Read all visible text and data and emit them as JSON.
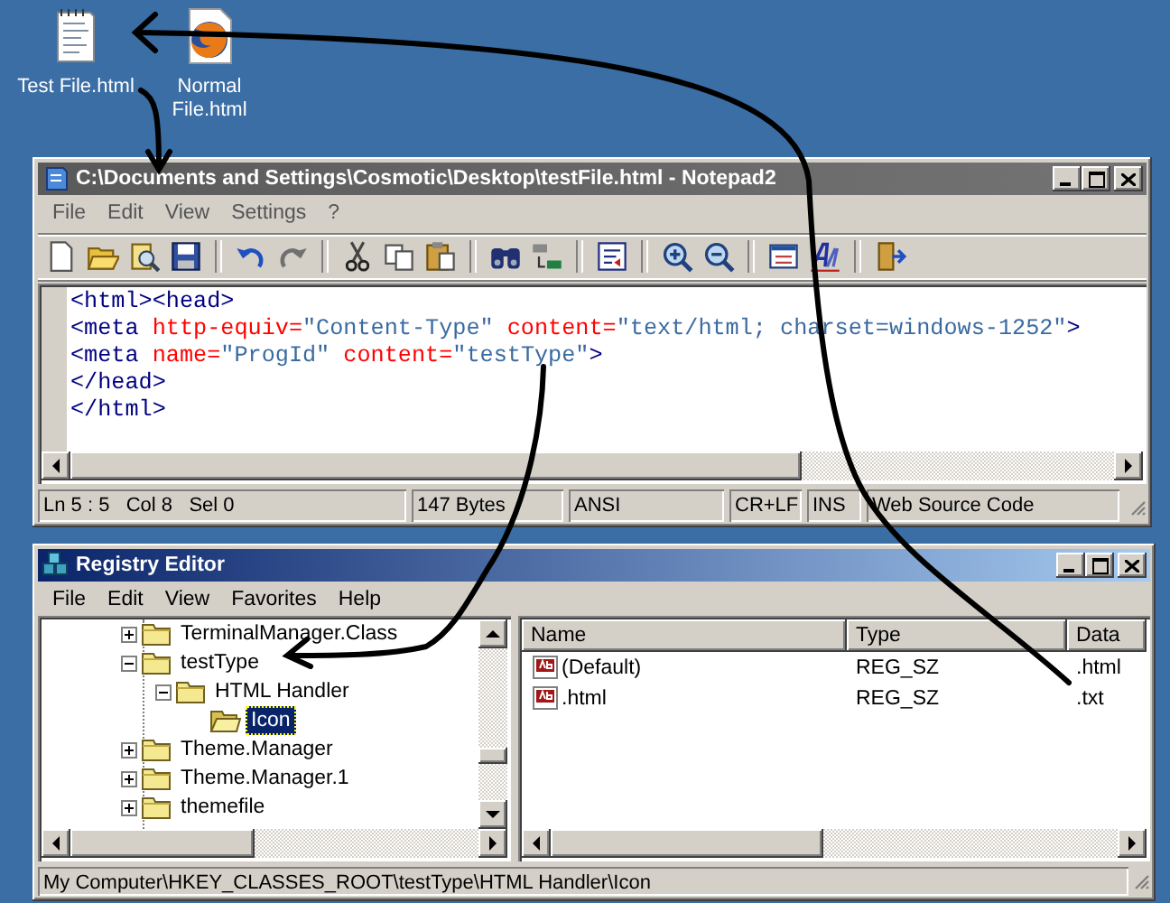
{
  "desktop_icons": [
    {
      "label": "Test File.html",
      "kind": "notepad"
    },
    {
      "label": "Normal File.html",
      "kind": "browser"
    }
  ],
  "notepad": {
    "title": "C:\\Documents and Settings\\Cosmotic\\Desktop\\testFile.html - Notepad2",
    "active": false,
    "menu": [
      "File",
      "Edit",
      "View",
      "Settings",
      "?"
    ],
    "code_lines": [
      [
        {
          "kind": "tag",
          "text": "<html><head>"
        }
      ],
      [
        {
          "kind": "tag",
          "text": "<meta"
        },
        {
          "kind": "attr",
          "text": " http-equiv"
        },
        {
          "kind": "op",
          "text": "="
        },
        {
          "kind": "value",
          "text": "\"Content-Type\""
        },
        {
          "kind": "attr",
          "text": " content"
        },
        {
          "kind": "op",
          "text": "="
        },
        {
          "kind": "value",
          "text": "\"text/html; charset=windows-1252\""
        },
        {
          "kind": "tag",
          "text": ">"
        }
      ],
      [
        {
          "kind": "tag",
          "text": "<meta"
        },
        {
          "kind": "attr",
          "text": " name"
        },
        {
          "kind": "op",
          "text": "="
        },
        {
          "kind": "value",
          "text": "\"ProgId\""
        },
        {
          "kind": "attr",
          "text": " content"
        },
        {
          "kind": "op",
          "text": "="
        },
        {
          "kind": "value",
          "text": "\"testType\""
        },
        {
          "kind": "tag",
          "text": ">"
        }
      ],
      [
        {
          "kind": "tag",
          "text": "</head>"
        }
      ],
      [
        {
          "kind": "tag",
          "text": "</html>"
        }
      ]
    ],
    "status_bar": [
      "Ln 5 : 5   Col 8   Sel 0",
      "147 Bytes",
      "ANSI",
      "CR+LF",
      "INS",
      "Web Source Code"
    ]
  },
  "registry": {
    "title": "Registry Editor",
    "active": true,
    "menu": [
      "File",
      "Edit",
      "View",
      "Favorites",
      "Help"
    ],
    "tree": [
      {
        "label": "TerminalManager.Class",
        "expanded": false,
        "selected": false
      },
      {
        "label": "testType",
        "expanded": true,
        "selected": false,
        "children": [
          {
            "label": "HTML Handler",
            "expanded": true,
            "selected": false,
            "children": [
              {
                "label": "Icon",
                "selected": true
              }
            ]
          }
        ]
      },
      {
        "label": "Theme.Manager",
        "expanded": false,
        "selected": false
      },
      {
        "label": "Theme.Manager.1",
        "expanded": false,
        "selected": false
      },
      {
        "label": "themefile",
        "expanded": false,
        "selected": false
      }
    ],
    "columns": [
      "Name",
      "Type",
      "Data"
    ],
    "rows": [
      {
        "name": "(Default)",
        "type": "REG_SZ",
        "data": ".html"
      },
      {
        "name": ".html",
        "type": "REG_SZ",
        "data": ".txt"
      }
    ],
    "status_bar": "My Computer\\HKEY_CLASSES_ROOT\\testType\\HTML Handler\\Icon"
  }
}
